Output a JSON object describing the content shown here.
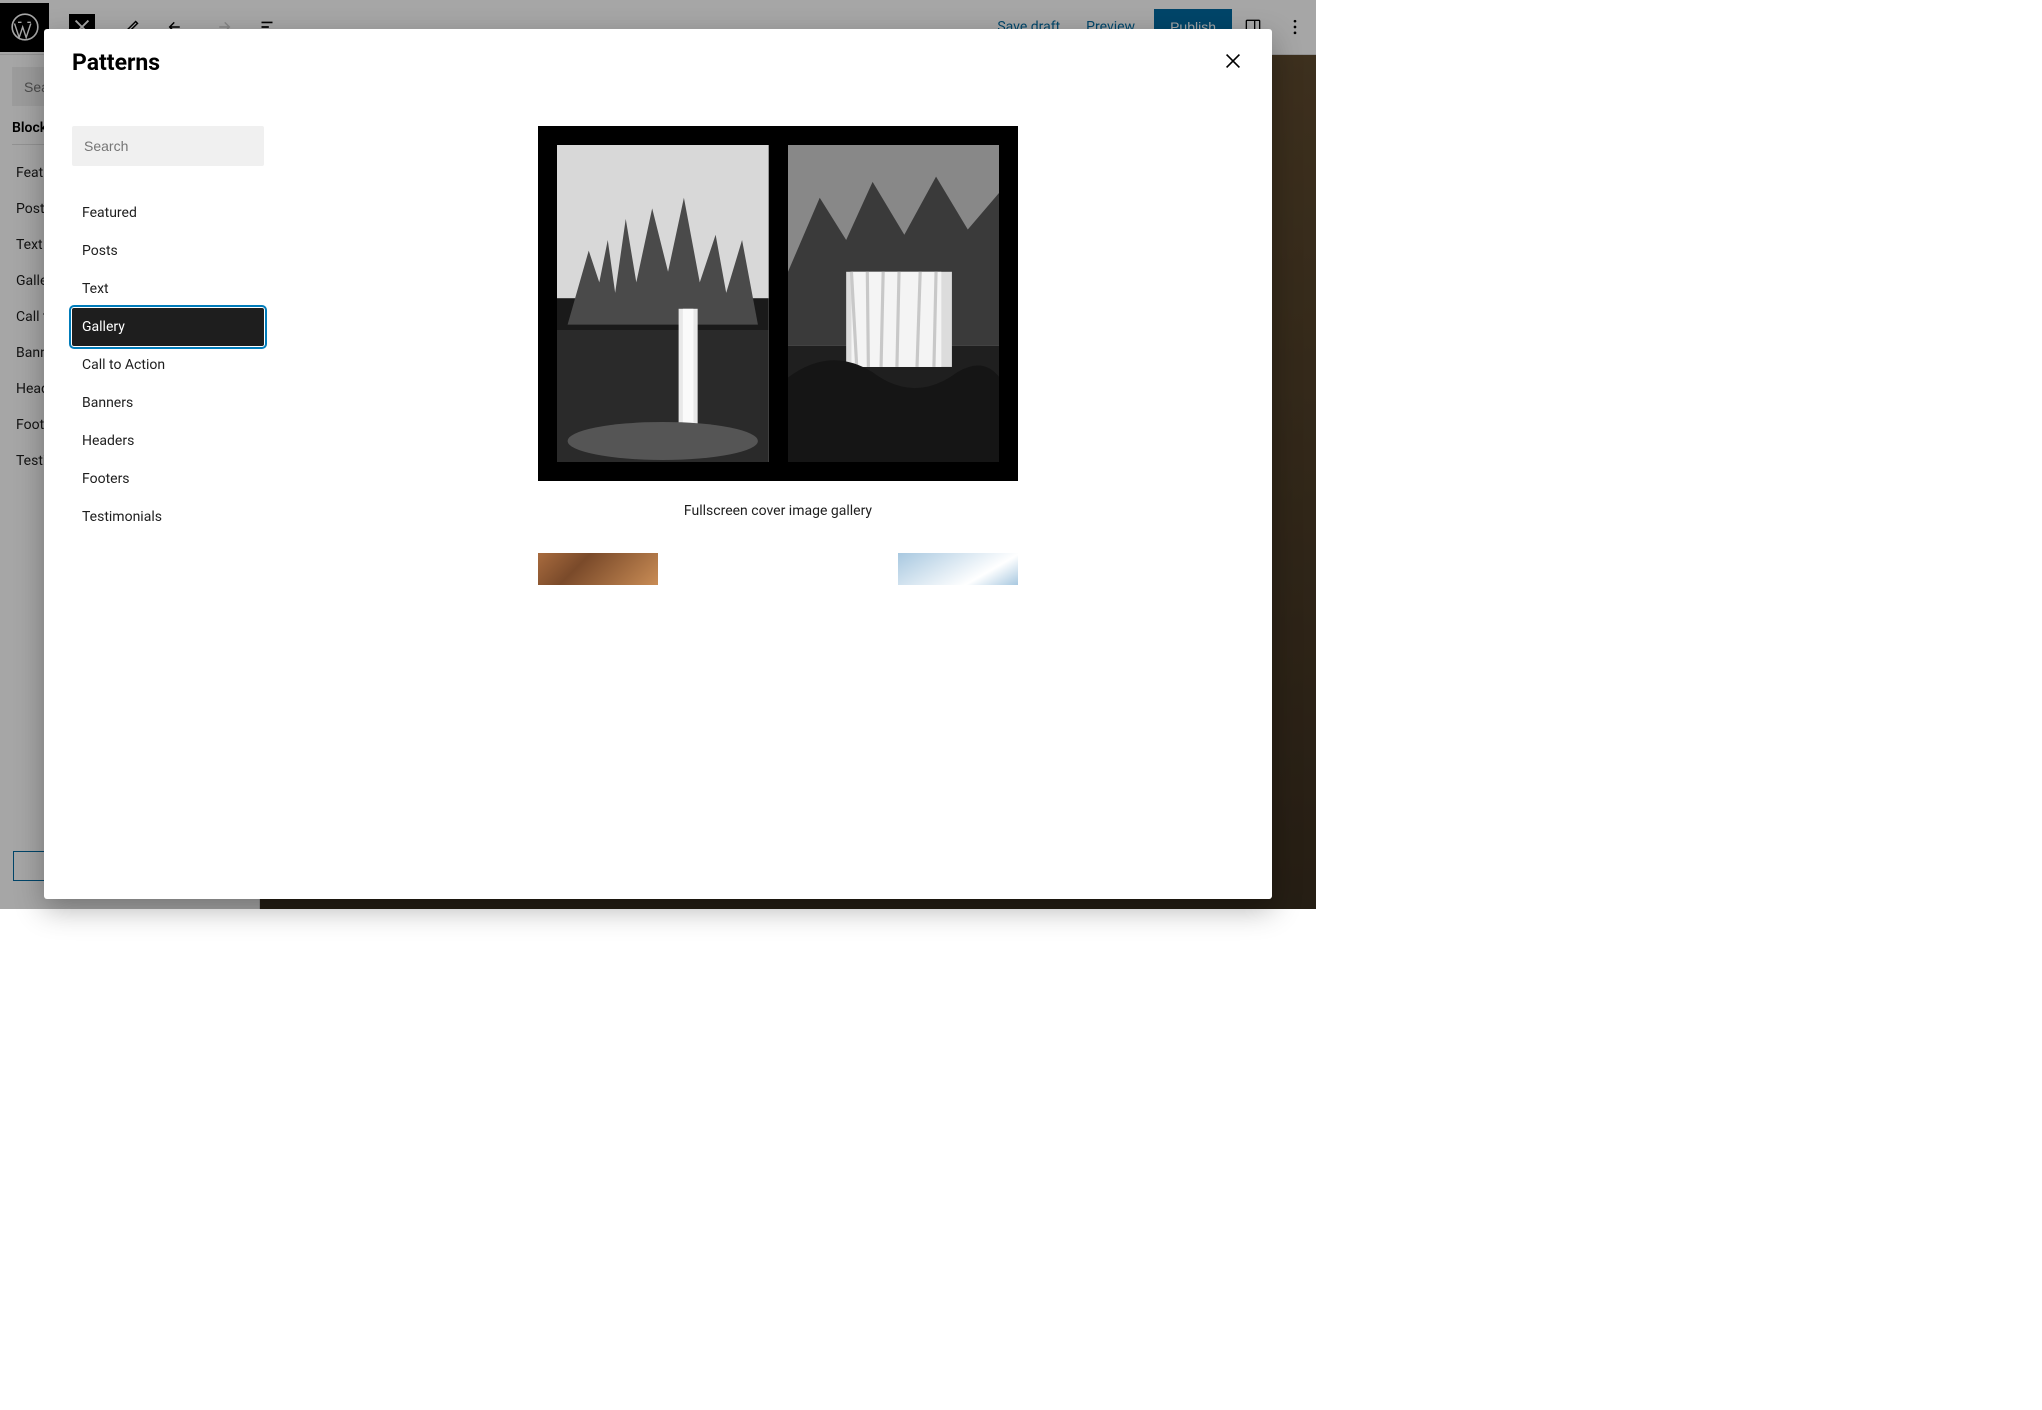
{
  "toolbar": {
    "save_draft": "Save draft",
    "preview": "Preview",
    "publish": "Publish"
  },
  "bg_sidebar": {
    "search_placeholder": "Search",
    "tab_blocks": "Blocks",
    "categories": [
      "Featured",
      "Posts",
      "Text",
      "Gallery",
      "Call to Action",
      "Banners",
      "Headers",
      "Footers",
      "Testimonials"
    ]
  },
  "modal": {
    "title": "Patterns",
    "search_placeholder": "Search",
    "categories": [
      {
        "label": "Featured",
        "active": false
      },
      {
        "label": "Posts",
        "active": false
      },
      {
        "label": "Text",
        "active": false
      },
      {
        "label": "Gallery",
        "active": true
      },
      {
        "label": "Call to Action",
        "active": false
      },
      {
        "label": "Banners",
        "active": false
      },
      {
        "label": "Headers",
        "active": false
      },
      {
        "label": "Footers",
        "active": false
      },
      {
        "label": "Testimonials",
        "active": false
      }
    ],
    "pattern_caption": "Fullscreen cover image gallery"
  }
}
